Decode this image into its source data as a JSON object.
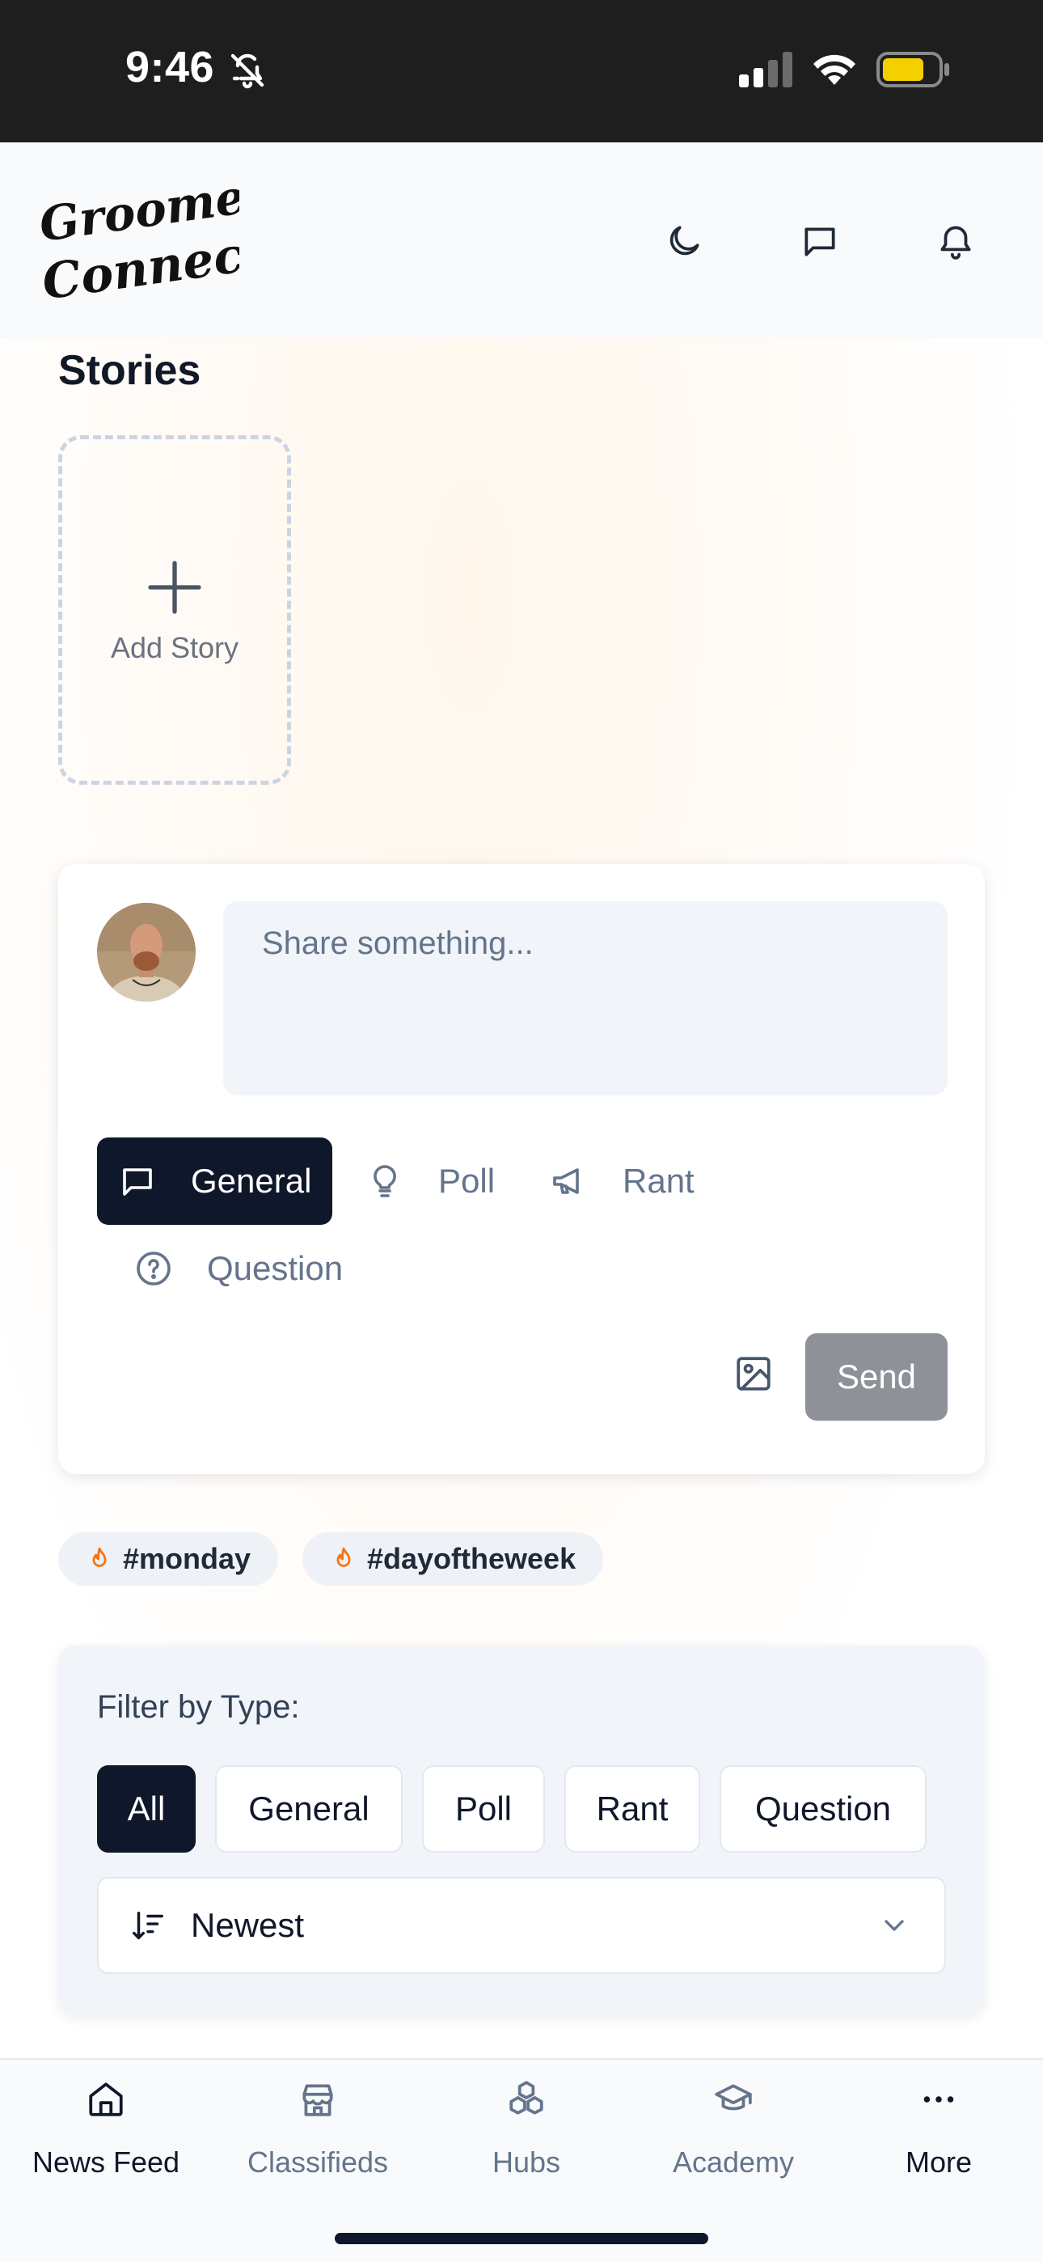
{
  "status_bar": {
    "time": "9:46",
    "icons": [
      "bell-muted-icon",
      "cellular-signal-icon",
      "wifi-icon",
      "battery-icon"
    ]
  },
  "header": {
    "logo_text": "Groomer Connect",
    "actions": [
      {
        "name": "dark-mode-toggle",
        "icon": "moon-icon"
      },
      {
        "name": "messages-button",
        "icon": "chat-bubble-icon"
      },
      {
        "name": "notifications-button",
        "icon": "bell-icon"
      }
    ]
  },
  "stories": {
    "title": "Stories",
    "add_label": "Add Story"
  },
  "composer": {
    "placeholder": "Share something...",
    "types": [
      {
        "label": "General",
        "icon": "chat-bubble-icon",
        "active": true
      },
      {
        "label": "Poll",
        "icon": "lightbulb-icon",
        "active": false
      },
      {
        "label": "Rant",
        "icon": "megaphone-icon",
        "active": false
      },
      {
        "label": "Question",
        "icon": "question-circle-icon",
        "active": false
      }
    ],
    "send_label": "Send"
  },
  "trending_tags": [
    "#monday",
    "#dayoftheweek"
  ],
  "filter": {
    "label": "Filter by Type:",
    "chips": [
      "All",
      "General",
      "Poll",
      "Rant",
      "Question"
    ],
    "active_chip": "All",
    "sort_value": "Newest"
  },
  "bottom_nav": {
    "items": [
      {
        "label": "News Feed",
        "icon": "home-icon"
      },
      {
        "label": "Classifieds",
        "icon": "store-icon"
      },
      {
        "label": "Hubs",
        "icon": "cubes-icon"
      },
      {
        "label": "Academy",
        "icon": "graduation-cap-icon"
      },
      {
        "label": "More",
        "icon": "more-dots-icon"
      }
    ]
  },
  "colors": {
    "primary_dark": "#0f172a",
    "muted_text": "#64748b",
    "send_disabled": "#8e9298",
    "tag_flame": "#f97316"
  }
}
